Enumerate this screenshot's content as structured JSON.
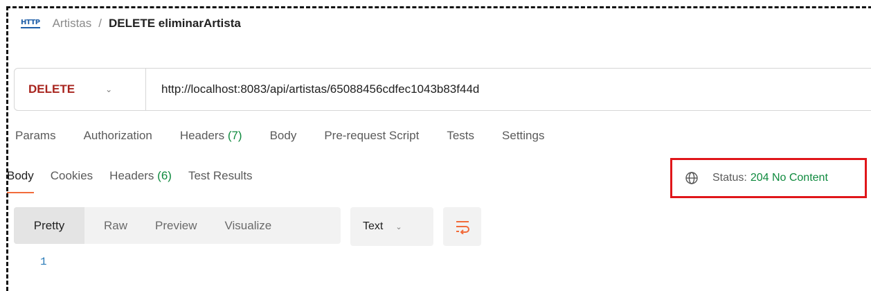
{
  "breadcrumb": {
    "icon": "http-icon",
    "icon_text": "HTTP",
    "parent": "Artistas",
    "separator": "/",
    "current": "DELETE eliminarArtista"
  },
  "request": {
    "method": "DELETE",
    "url": "http://localhost:8083/api/artistas/65088456cdfec1043b83f44d"
  },
  "request_tabs": [
    {
      "label": "Params"
    },
    {
      "label": "Authorization"
    },
    {
      "label": "Headers",
      "count": "(7)"
    },
    {
      "label": "Body"
    },
    {
      "label": "Pre-request Script"
    },
    {
      "label": "Tests"
    },
    {
      "label": "Settings"
    }
  ],
  "response_tabs": [
    {
      "label": "Body",
      "active": true
    },
    {
      "label": "Cookies"
    },
    {
      "label": "Headers",
      "count": "(6)"
    },
    {
      "label": "Test Results"
    }
  ],
  "status": {
    "label": "Status:",
    "value": "204 No Content",
    "color": "#0f8a3e",
    "highlight_color": "#e0161a"
  },
  "view_modes": [
    "Pretty",
    "Raw",
    "Preview",
    "Visualize"
  ],
  "format": {
    "selected": "Text"
  },
  "body": {
    "line_numbers": [
      "1"
    ]
  },
  "colors": {
    "method_delete": "#a8241e",
    "active_tab_underline": "#f26b3a",
    "line_number": "#2a7bb8"
  }
}
